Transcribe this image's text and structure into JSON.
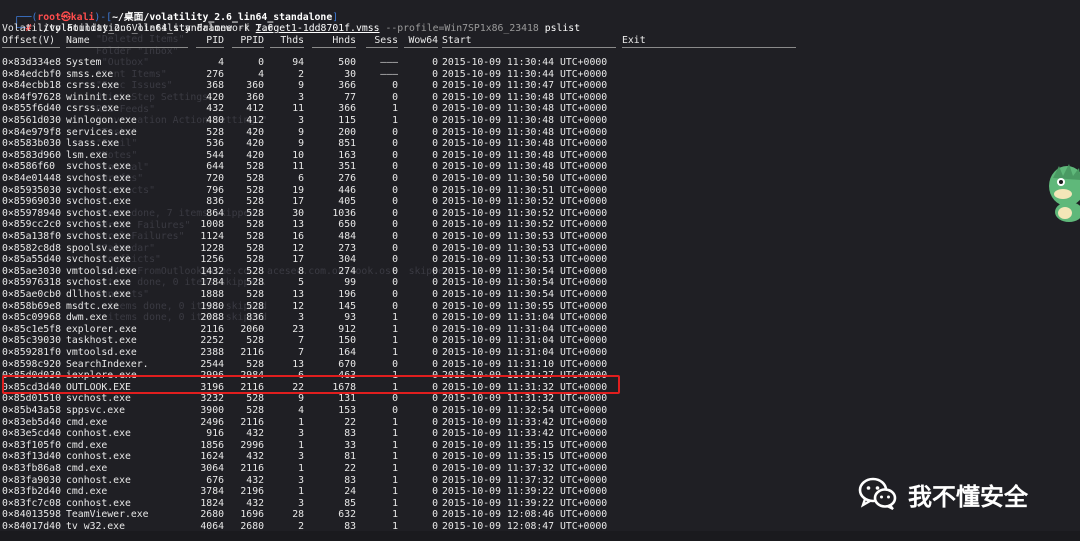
{
  "terminal": {
    "prompt": {
      "frame_top": "┌──(",
      "user": "root",
      "at": "㉿",
      "host": "kali",
      "close": ")-[",
      "path": "~/桌面/volatility_2.6_lin64_standalone",
      "end": "]",
      "frame_bottom": "└─",
      "hash": "#",
      "command": "./volatility_2.6_lin64_standalone",
      "flag_f": "-f",
      "file": "Target1-1dd8701f.vmss",
      "flag_profile": "--profile=Win7SP1x86_23418",
      "plugin": "pslist"
    },
    "banner": "Volatility Foundation Volatility Framework 2.6",
    "columns": [
      "Offset(V)",
      "Name",
      "PID",
      "PPID",
      "Thds",
      "Hnds",
      "Sess",
      "Wow64",
      "Start",
      "Exit"
    ],
    "rows": [
      [
        "0×83d334e8",
        "System",
        "4",
        "0",
        "94",
        "500",
        "———",
        "0",
        "2015-10-09 11:30:44 UTC+0000"
      ],
      [
        "0×84edcbf0",
        "smss.exe",
        "276",
        "4",
        "2",
        "30",
        "———",
        "0",
        "2015-10-09 11:30:44 UTC+0000"
      ],
      [
        "0×84ecbb18",
        "csrss.exe",
        "368",
        "360",
        "9",
        "366",
        "0",
        "0",
        "2015-10-09 11:30:47 UTC+0000"
      ],
      [
        "0×84f97628",
        "wininit.exe",
        "420",
        "360",
        "3",
        "77",
        "0",
        "0",
        "2015-10-09 11:30:48 UTC+0000"
      ],
      [
        "0×855f6d40",
        "csrss.exe",
        "432",
        "412",
        "11",
        "366",
        "1",
        "0",
        "2015-10-09 11:30:48 UTC+0000"
      ],
      [
        "0×8561d030",
        "winlogon.exe",
        "480",
        "412",
        "3",
        "115",
        "1",
        "0",
        "2015-10-09 11:30:48 UTC+0000"
      ],
      [
        "0×84e979f8",
        "services.exe",
        "528",
        "420",
        "9",
        "200",
        "0",
        "0",
        "2015-10-09 11:30:48 UTC+0000"
      ],
      [
        "0×8583b030",
        "lsass.exe",
        "536",
        "420",
        "9",
        "851",
        "0",
        "0",
        "2015-10-09 11:30:48 UTC+0000"
      ],
      [
        "0×8583d960",
        "lsm.exe",
        "544",
        "420",
        "10",
        "163",
        "0",
        "0",
        "2015-10-09 11:30:48 UTC+0000"
      ],
      [
        "0×8586f60",
        "svchost.exe",
        "644",
        "528",
        "11",
        "351",
        "0",
        "0",
        "2015-10-09 11:30:48 UTC+0000"
      ],
      [
        "0×84e01448",
        "svchost.exe",
        "720",
        "528",
        "6",
        "276",
        "0",
        "0",
        "2015-10-09 11:30:50 UTC+0000"
      ],
      [
        "0×85935030",
        "svchost.exe",
        "796",
        "528",
        "19",
        "446",
        "0",
        "0",
        "2015-10-09 11:30:51 UTC+0000"
      ],
      [
        "0×85969030",
        "svchost.exe",
        "836",
        "528",
        "17",
        "405",
        "0",
        "0",
        "2015-10-09 11:30:52 UTC+0000"
      ],
      [
        "0×85978940",
        "svchost.exe",
        "864",
        "528",
        "30",
        "1036",
        "0",
        "0",
        "2015-10-09 11:30:52 UTC+0000"
      ],
      [
        "0×859cc2c0",
        "svchost.exe",
        "1008",
        "528",
        "13",
        "650",
        "0",
        "0",
        "2015-10-09 11:30:52 UTC+0000"
      ],
      [
        "0×85a138f0",
        "svchost.exe",
        "1124",
        "528",
        "16",
        "484",
        "0",
        "0",
        "2015-10-09 11:30:53 UTC+0000"
      ],
      [
        "0×8582c8d8",
        "spoolsv.exe",
        "1228",
        "528",
        "12",
        "273",
        "0",
        "0",
        "2015-10-09 11:30:53 UTC+0000"
      ],
      [
        "0×85a55d40",
        "svchost.exe",
        "1256",
        "528",
        "17",
        "304",
        "0",
        "0",
        "2015-10-09 11:30:53 UTC+0000"
      ],
      [
        "0×85ae3030",
        "vmtoolsd.exe",
        "1432",
        "528",
        "8",
        "274",
        "0",
        "0",
        "2015-10-09 11:30:54 UTC+0000"
      ],
      [
        "0×85976318",
        "svchost.exe",
        "1784",
        "528",
        "5",
        "99",
        "0",
        "0",
        "2015-10-09 11:30:54 UTC+0000"
      ],
      [
        "0×85ae0cb0",
        "dllhost.exe",
        "1888",
        "528",
        "13",
        "196",
        "0",
        "0",
        "2015-10-09 11:30:54 UTC+0000"
      ],
      [
        "0×858b69e8",
        "msdtc.exe",
        "1980",
        "528",
        "12",
        "145",
        "0",
        "0",
        "2015-10-09 11:30:55 UTC+0000"
      ],
      [
        "0×85c09968",
        "dwm.exe",
        "2088",
        "836",
        "3",
        "93",
        "1",
        "0",
        "2015-10-09 11:31:04 UTC+0000"
      ],
      [
        "0×85c1e5f8",
        "explorer.exe",
        "2116",
        "2060",
        "23",
        "912",
        "1",
        "0",
        "2015-10-09 11:31:04 UTC+0000"
      ],
      [
        "0×85c39030",
        "taskhost.exe",
        "2252",
        "528",
        "7",
        "150",
        "1",
        "0",
        "2015-10-09 11:31:04 UTC+0000"
      ],
      [
        "0×859281f0",
        "vmtoolsd.exe",
        "2388",
        "2116",
        "7",
        "164",
        "1",
        "0",
        "2015-10-09 11:31:04 UTC+0000"
      ],
      [
        "0×8598c920",
        "SearchIndexer.",
        "2544",
        "528",
        "13",
        "670",
        "0",
        "0",
        "2015-10-09 11:31:10 UTC+0000"
      ],
      [
        "0×85d0d030",
        "iexplore.exe",
        "2996",
        "2984",
        "6",
        "463",
        "1",
        "0",
        "2015-10-09 11:31:27 UTC+0000"
      ],
      [
        "0×85cd3d40",
        "OUTLOOK.EXE",
        "3196",
        "2116",
        "22",
        "1678",
        "1",
        "0",
        "2015-10-09 11:31:32 UTC+0000"
      ],
      [
        "0×85d01510",
        "svchost.exe",
        "3232",
        "528",
        "9",
        "131",
        "0",
        "0",
        "2015-10-09 11:31:32 UTC+0000"
      ],
      [
        "0×85b43a58",
        "sppsvc.exe",
        "3900",
        "528",
        "4",
        "153",
        "0",
        "0",
        "2015-10-09 11:32:54 UTC+0000"
      ],
      [
        "0×83eb5d40",
        "cmd.exe",
        "2496",
        "2116",
        "1",
        "22",
        "1",
        "0",
        "2015-10-09 11:33:42 UTC+0000"
      ],
      [
        "0×83e5cd40",
        "conhost.exe",
        "916",
        "432",
        "3",
        "83",
        "1",
        "0",
        "2015-10-09 11:33:42 UTC+0000"
      ],
      [
        "0×83f105f0",
        "cmd.exe",
        "1856",
        "2996",
        "1",
        "33",
        "1",
        "0",
        "2015-10-09 11:35:15 UTC+0000"
      ],
      [
        "0×83f13d40",
        "conhost.exe",
        "1624",
        "432",
        "3",
        "81",
        "1",
        "0",
        "2015-10-09 11:35:15 UTC+0000"
      ],
      [
        "0×83fb86a8",
        "cmd.exe",
        "3064",
        "2116",
        "1",
        "22",
        "1",
        "0",
        "2015-10-09 11:37:32 UTC+0000"
      ],
      [
        "0×83fa9030",
        "conhost.exe",
        "676",
        "432",
        "3",
        "83",
        "1",
        "0",
        "2015-10-09 11:37:32 UTC+0000"
      ],
      [
        "0×83fb2d40",
        "cmd.exe",
        "3784",
        "2196",
        "1",
        "24",
        "1",
        "0",
        "2015-10-09 11:39:22 UTC+0000"
      ],
      [
        "0×83fc7c08",
        "conhost.exe",
        "1824",
        "432",
        "3",
        "85",
        "1",
        "0",
        "2015-10-09 11:39:22 UTC+0000"
      ],
      [
        "0×84013598",
        "TeamViewer.exe",
        "2680",
        "1696",
        "28",
        "632",
        "1",
        "0",
        "2015-10-09 12:08:46 UTC+0000"
      ],
      [
        "0×84017d40",
        "tv_w32.exe",
        "4064",
        "2680",
        "2",
        "83",
        "1",
        "0",
        "2015-10-09 12:08:47 UTC+0000"
      ]
    ],
    "highlighted_row_name": "OUTLOOK.EXE"
  },
  "watermark": {
    "text": "我不懂安全",
    "icon": "wechat-icon"
  },
  "colors": {
    "background": "#1f1f24",
    "prompt_user": "#ff4d4d",
    "prompt_frame": "#3f7bd7",
    "highlight": "#e01e1e"
  }
}
